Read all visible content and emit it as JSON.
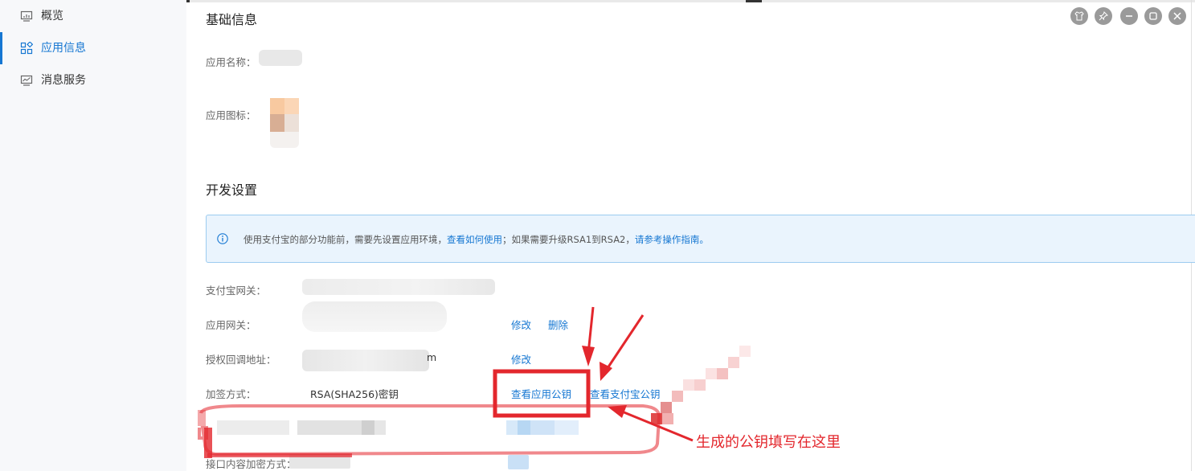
{
  "sidebar": {
    "items": [
      {
        "label": "概览",
        "icon": "monitor-icon",
        "active": false
      },
      {
        "label": "应用信息",
        "icon": "apps-grid-icon",
        "active": true
      },
      {
        "label": "消息服务",
        "icon": "chart-screen-icon",
        "active": false
      }
    ]
  },
  "basic_info": {
    "title": "基础信息",
    "app_name_label": "应用名称：",
    "app_icon_label": "应用图标："
  },
  "dev_settings": {
    "title": "开发设置",
    "notice": {
      "prefix": "使用支付宝的部分功能前，需要先设置应用环境，",
      "link1": "查看如何使用",
      "middle": "；如果需要升级RSA1到RSA2，",
      "link2": "请参考操作指南。"
    },
    "gateway_label": "支付宝网关：",
    "app_gateway_label": "应用网关：",
    "app_gateway_edit": "修改",
    "app_gateway_delete": "删除",
    "callback_label": "授权回调地址：",
    "callback_tail": "m",
    "callback_edit": "修改",
    "sign_label": "加签方式：",
    "sign_value": "RSA(SHA256)密钥",
    "view_app_public_key": "查看应用公钥",
    "view_alipay_public_key": "查看支付宝公钥",
    "encrypt_label": "接口内容加密方式："
  },
  "annotation": {
    "text": "生成的公钥填写在这里",
    "color": "#e3272d"
  },
  "window_controls": [
    "shirt-icon",
    "pin-icon",
    "minimize-icon",
    "maximize-icon",
    "close-icon"
  ],
  "colors": {
    "accent": "#1677d2",
    "annotation": "#e3272d",
    "notice_bg": "#eaf4fd"
  }
}
